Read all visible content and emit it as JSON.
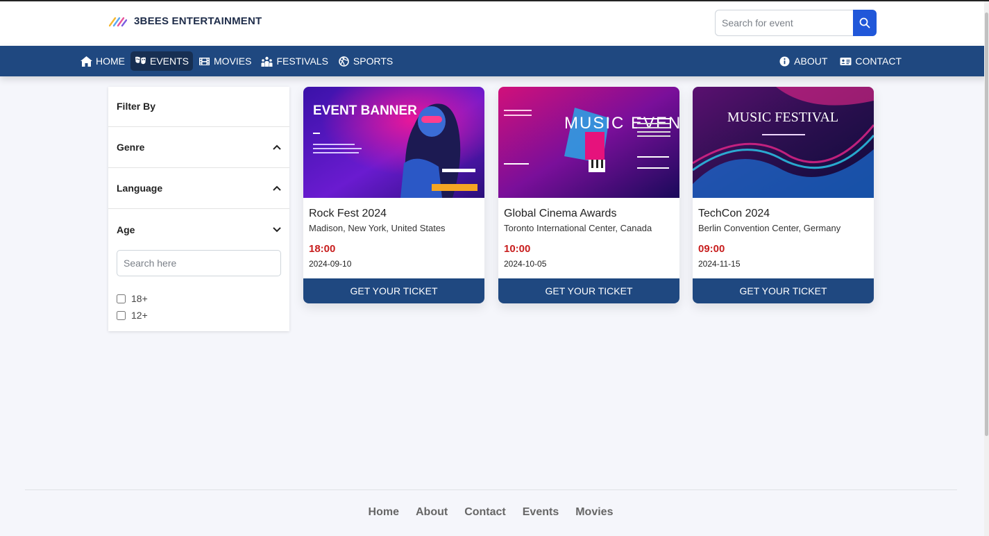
{
  "header": {
    "brand_name": "3BEES ENTERTAINMENT",
    "search_placeholder": "Search for event"
  },
  "nav": {
    "left": [
      {
        "label": "HOME",
        "icon": "home-icon"
      },
      {
        "label": "EVENTS",
        "icon": "masks-icon",
        "active": true
      },
      {
        "label": "MOVIES",
        "icon": "film-icon"
      },
      {
        "label": "FESTIVALS",
        "icon": "crowd-icon"
      },
      {
        "label": "SPORTS",
        "icon": "ball-icon"
      }
    ],
    "right": [
      {
        "label": "ABOUT",
        "icon": "info-icon"
      },
      {
        "label": "CONTACT",
        "icon": "contact-card-icon"
      }
    ]
  },
  "sidebar": {
    "title": "Filter By",
    "sections": [
      {
        "label": "Genre",
        "state": "collapsed"
      },
      {
        "label": "Language",
        "state": "collapsed"
      },
      {
        "label": "Age",
        "state": "expanded"
      }
    ],
    "age_search_placeholder": "Search here",
    "age_options": [
      "18+",
      "12+"
    ]
  },
  "events": [
    {
      "image_text": "EVENT BANNER",
      "title": "Rock Fest 2024",
      "location": "Madison, New York, United States",
      "time": "18:00",
      "date": "2024-09-10",
      "button": "GET YOUR TICKET"
    },
    {
      "image_text": "MUSIC EVENT",
      "title": "Global Cinema Awards",
      "location": "Toronto International Center, Canada",
      "time": "10:00",
      "date": "2024-10-05",
      "button": "GET YOUR TICKET"
    },
    {
      "image_text": "MUSIC FESTIVAL",
      "title": "TechCon 2024",
      "location": "Berlin Convention Center, Germany",
      "time": "09:00",
      "date": "2024-11-15",
      "button": "GET YOUR TICKET"
    }
  ],
  "footer": {
    "links": [
      "Home",
      "About",
      "Contact",
      "Events",
      "Movies"
    ]
  },
  "colors": {
    "nav_bg": "#1f4880",
    "accent_blue": "#2057d9",
    "time_red": "#c81e1e",
    "page_bg": "#f5f6fb"
  }
}
